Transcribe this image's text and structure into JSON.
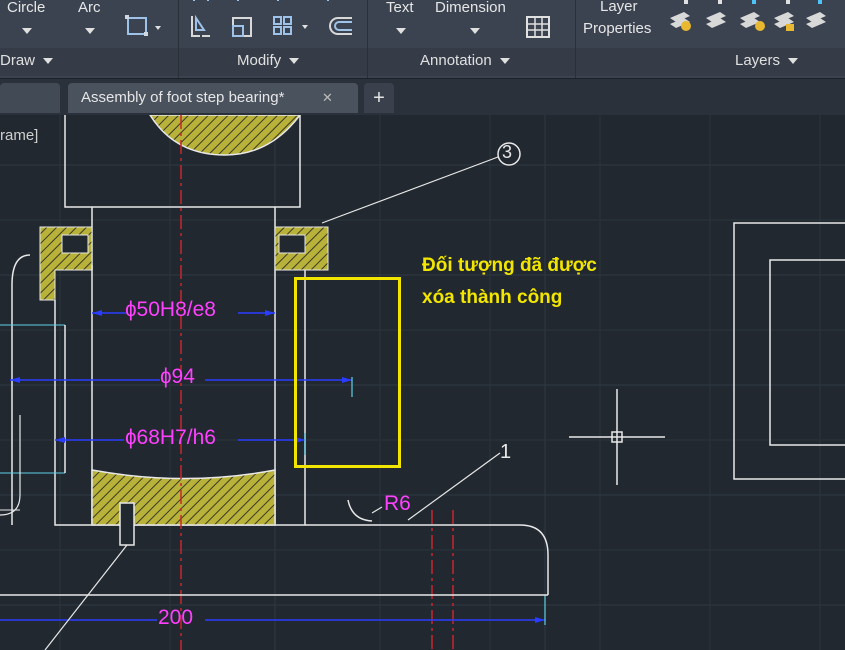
{
  "ribbon": {
    "draw": {
      "circle": "Circle",
      "arc": "Arc",
      "title": "Draw"
    },
    "modify": {
      "title": "Modify"
    },
    "annotation": {
      "text": "Text",
      "dimension": "Dimension",
      "title": "Annotation"
    },
    "layers": {
      "layer_line1": "Layer",
      "layer_line2": "Properties",
      "title": "Layers"
    }
  },
  "tabs": {
    "active": "Assembly of foot step bearing*",
    "add": "+",
    "close": "✕"
  },
  "viewport": {
    "label": "rame]",
    "note_line1": "Đối tượng đã được",
    "note_line2": "xóa thành công"
  },
  "drawing": {
    "dim_phi50": "ɸ50H8/e8",
    "dim_phi94": "ɸ94",
    "dim_phi68": "ɸ68H7/h6",
    "dim_r6": "R6",
    "dim_200": "200",
    "balloon_3": "3",
    "label_1": "1"
  },
  "colors": {
    "highlight": "#f2e600",
    "dimension": "#ff40ff",
    "dim_line": "#2a3cff",
    "center_line": "#c8262a",
    "hatch": "#c8c23a"
  }
}
